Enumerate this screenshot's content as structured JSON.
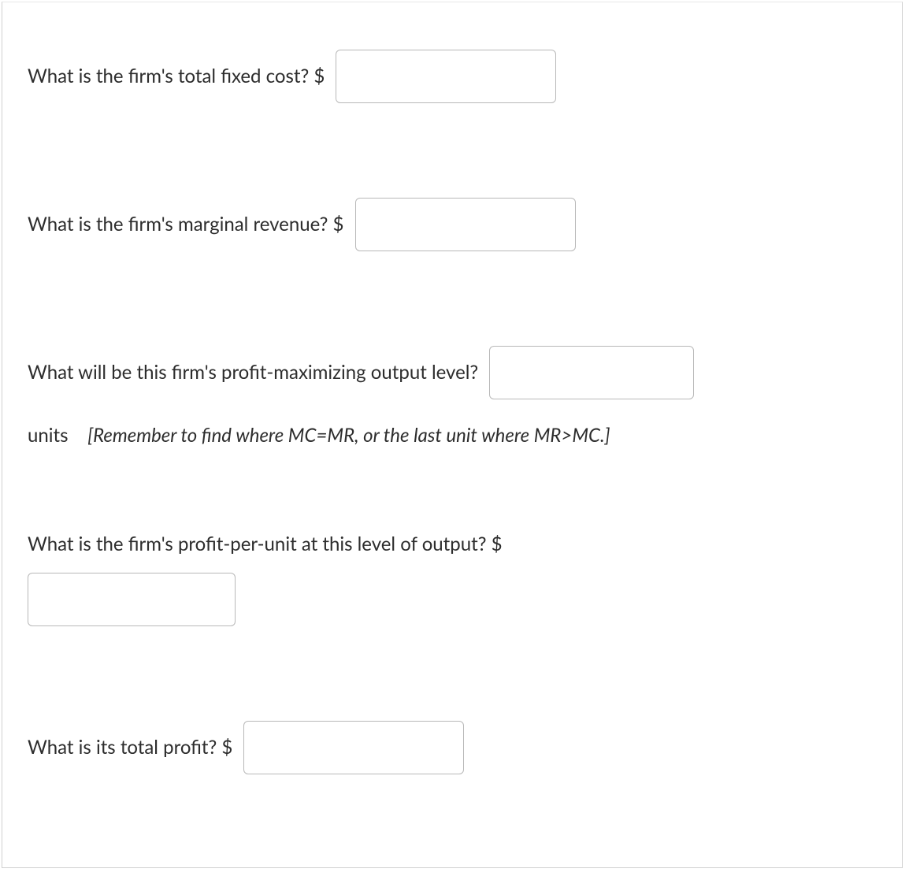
{
  "questions": {
    "q1": {
      "text": "What is the firm's total fixed cost? $",
      "value": ""
    },
    "q2": {
      "text": "What is the firm's marginal revenue? $",
      "value": ""
    },
    "q3": {
      "text": "What will be this firm's profit-maximizing output level?",
      "value": "",
      "units_label": "units",
      "hint": "[Remember to find where MC=MR, or the last unit where MR>MC.]"
    },
    "q4": {
      "text": "What is the firm's profit-per-unit at this level of output? $",
      "value": ""
    },
    "q5": {
      "text": "What is its total profit? $",
      "value": ""
    }
  }
}
